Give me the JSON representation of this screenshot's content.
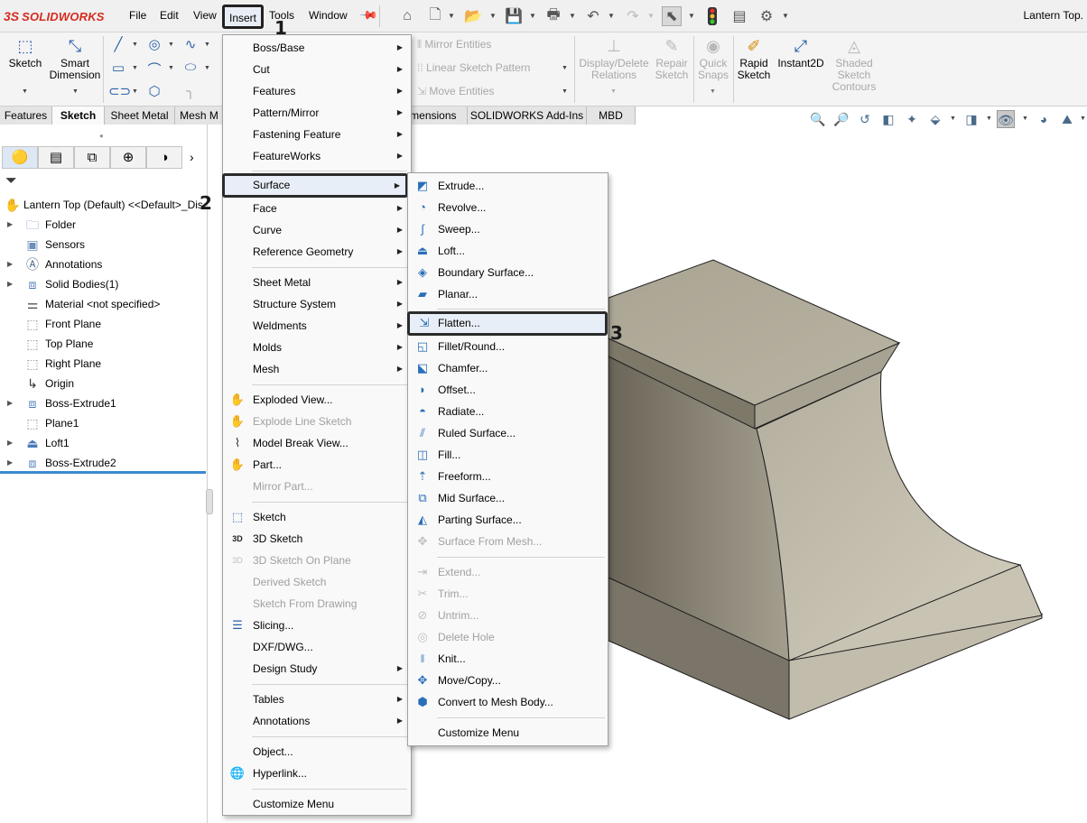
{
  "app": {
    "brand_ds": "3S",
    "brand_name": "SOLIDWORKS",
    "doc_title": "Lantern Top."
  },
  "menubar": {
    "file": "File",
    "edit": "Edit",
    "view": "View",
    "insert": "Insert",
    "tools": "Tools",
    "window": "Window"
  },
  "cmd": {
    "sketch": "Sketch",
    "smart_dim_1": "Smart",
    "smart_dim_2": "Dimension",
    "mirror": "Mirror Entities",
    "linear_pattern": "Linear Sketch Pattern",
    "move": "Move Entities",
    "display_delete_1": "Display/Delete",
    "display_delete_2": "Relations",
    "repair_1": "Repair",
    "repair_2": "Sketch",
    "quick_1": "Quick",
    "quick_2": "Snaps",
    "rapid_1": "Rapid",
    "rapid_2": "Sketch",
    "instant2d": "Instant2D",
    "shaded_1": "Shaded",
    "shaded_2": "Sketch",
    "shaded_3": "Contours"
  },
  "tabs": [
    "Features",
    "Sketch",
    "Sheet Metal",
    "Mesh M",
    "imensions",
    "SOLIDWORKS Add-Ins",
    "MBD"
  ],
  "tree": {
    "root": "Lantern Top (Default) <<Default>_Dis",
    "items": [
      "Folder",
      "Sensors",
      "Annotations",
      "Solid Bodies(1)",
      "Material <not specified>",
      "Front Plane",
      "Top Plane",
      "Right Plane",
      "Origin",
      "Boss-Extrude1",
      "Plane1",
      "Loft1",
      "Boss-Extrude2"
    ]
  },
  "insert_menu": [
    "Boss/Base",
    "Cut",
    "Features",
    "Pattern/Mirror",
    "Fastening Feature",
    "FeatureWorks",
    "Surface",
    "Face",
    "Curve",
    "Reference Geometry",
    "Sheet Metal",
    "Structure System",
    "Weldments",
    "Molds",
    "Mesh",
    "Exploded View...",
    "Explode Line Sketch",
    "Model Break View...",
    "Part...",
    "Mirror Part...",
    "Sketch",
    "3D Sketch",
    "3D Sketch On Plane",
    "Derived Sketch",
    "Sketch From Drawing",
    "Slicing...",
    "DXF/DWG...",
    "Design Study",
    "Tables",
    "Annotations",
    "Object...",
    "Hyperlink...",
    "Customize Menu"
  ],
  "surface_menu": [
    "Extrude...",
    "Revolve...",
    "Sweep...",
    "Loft...",
    "Boundary Surface...",
    "Planar...",
    "Flatten...",
    "Fillet/Round...",
    "Chamfer...",
    "Offset...",
    "Radiate...",
    "Ruled Surface...",
    "Fill...",
    "Freeform...",
    "Mid Surface...",
    "Parting Surface...",
    "Surface From Mesh...",
    "Extend...",
    "Trim...",
    "Untrim...",
    "Delete Hole",
    "Knit...",
    "Move/Copy...",
    "Convert to Mesh Body...",
    "Customize Menu"
  ],
  "steps": [
    "1",
    "2",
    "3"
  ]
}
